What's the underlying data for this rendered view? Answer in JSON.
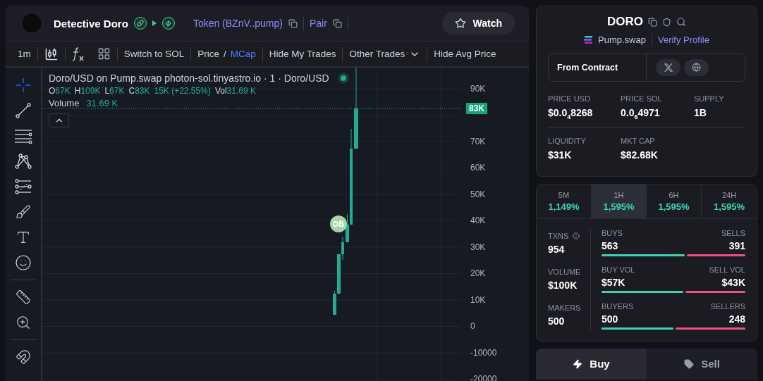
{
  "header": {
    "name": "Detective Doro",
    "token_link": "Token (BZnV..pump)",
    "pair_link": "Pair",
    "watch_button": "Watch"
  },
  "toolbar": {
    "interval": "1m",
    "switch_currency": "Switch to SOL",
    "price_toggle": [
      {
        "label": "Price",
        "selected": false
      },
      {
        "label": "MCap",
        "selected": true
      }
    ],
    "toggle_separator": "/",
    "hide_my_trades": "Hide My Trades",
    "other_trades": "Other Trades",
    "hide_avg_price": "Hide Avg Price"
  },
  "chart": {
    "title": "Doro/USD on Pump.swap photon-sol.tinyastro.io · 1 · Doro/USD",
    "ohlc": [
      {
        "label": "O",
        "value": "67K"
      },
      {
        "label": "H",
        "value": "109K"
      },
      {
        "label": "L",
        "value": "67K"
      },
      {
        "label": "C",
        "value": "83K"
      }
    ],
    "change": "15K (+22.55%)",
    "vol": {
      "label": "Vol",
      "value": "31.69 K"
    },
    "volume": {
      "label": "Volume",
      "value": "31.69 K"
    },
    "price_axis": [
      "90K",
      "70K",
      "60K",
      "50K",
      "40K",
      "30K",
      "20K",
      "10K",
      "0",
      "-10000",
      "-20000"
    ],
    "current_price": "83K",
    "trade_marker": "DB"
  },
  "token": {
    "symbol": "DORO",
    "exchange": "Pump.swap",
    "verify_link": "Verify Profile",
    "contract_label": "From Contract",
    "stats": [
      {
        "label": "PRICE USD",
        "value": "$0.0$_{4}$8268"
      },
      {
        "label": "PRICE SOL",
        "value": "0.0$_{6}$4971"
      },
      {
        "label": "SUPPLY",
        "value": "1B"
      },
      {
        "label": "LIQUIDITY",
        "value": "$31K"
      },
      {
        "label": "MKT CAP",
        "value": "$82.68K"
      }
    ]
  },
  "periods": [
    {
      "label": "5M",
      "change": "1,149%",
      "selected": false
    },
    {
      "label": "1H",
      "change": "1,595%",
      "selected": true
    },
    {
      "label": "6H",
      "change": "1,595%",
      "selected": false
    },
    {
      "label": "24H",
      "change": "1,595%",
      "selected": false
    }
  ],
  "totals": [
    {
      "label": "TXNS",
      "value": "954",
      "info": true
    },
    {
      "label": "VOLUME",
      "value": "$100K",
      "info": false
    },
    {
      "label": "MAKERS",
      "value": "500",
      "info": false
    }
  ],
  "splits": [
    {
      "left_label": "BUYS",
      "left_value": "563",
      "right_label": "SELLS",
      "right_value": "391",
      "level": 0.58
    },
    {
      "left_label": "BUY VOL",
      "left_value": "$57K",
      "right_label": "SELL VOL",
      "right_value": "$43K",
      "level": 0.57
    },
    {
      "left_label": "BUYERS",
      "left_value": "500",
      "right_label": "SELLERS",
      "right_value": "248",
      "level": 0.5
    }
  ],
  "trade_tabs": [
    {
      "label": "Buy",
      "kind": "buy",
      "selected": true
    },
    {
      "label": "Sell",
      "kind": "sell",
      "selected": false
    }
  ]
}
